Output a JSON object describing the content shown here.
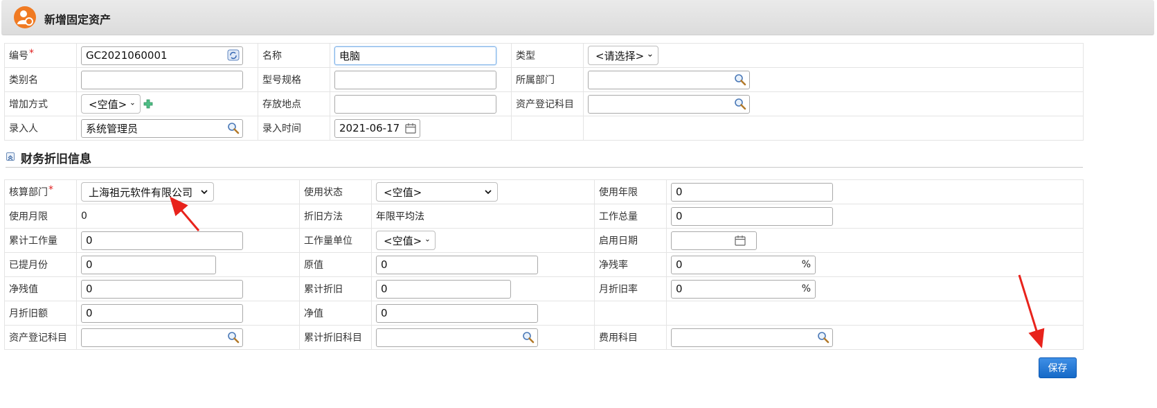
{
  "header": {
    "title": "新增固定资产"
  },
  "basic": {
    "code": {
      "label": "编号",
      "required": "*",
      "value": "GC2021060001"
    },
    "name": {
      "label": "名称",
      "value": "电脑"
    },
    "type": {
      "label": "类型",
      "value": "<请选择>"
    },
    "category_name": {
      "label": "类别名",
      "value": ""
    },
    "model": {
      "label": "型号规格",
      "value": ""
    },
    "department": {
      "label": "所属部门",
      "value": ""
    },
    "add_method": {
      "label": "增加方式",
      "value": "<空值>"
    },
    "location": {
      "label": "存放地点",
      "value": ""
    },
    "asset_account": {
      "label": "资产登记科目",
      "value": ""
    },
    "entered_by": {
      "label": "录入人",
      "value": "系统管理员"
    },
    "entry_time": {
      "label": "录入时间",
      "value": "2021-06-17"
    }
  },
  "finance": {
    "section_title": "财务折旧信息",
    "acct_dept": {
      "label": "核算部门",
      "required": "*",
      "value": "上海祖元软件有限公司"
    },
    "use_status": {
      "label": "使用状态",
      "value": "<空值>"
    },
    "use_years": {
      "label": "使用年限",
      "value": "0"
    },
    "use_months": {
      "label": "使用月限",
      "value": "0"
    },
    "depr_method": {
      "label": "折旧方法",
      "value": "年限平均法"
    },
    "total_work": {
      "label": "工作总量",
      "value": "0"
    },
    "accum_work": {
      "label": "累计工作量",
      "value": "0"
    },
    "work_unit": {
      "label": "工作量单位",
      "value": "<空值>"
    },
    "start_date": {
      "label": "启用日期",
      "value": ""
    },
    "months_accrued": {
      "label": "已提月份",
      "value": "0"
    },
    "original_value": {
      "label": "原值",
      "value": "0"
    },
    "residual_rate": {
      "label": "净残率",
      "value": "0",
      "unit": "%"
    },
    "residual_value": {
      "label": "净残值",
      "value": "0"
    },
    "accum_depr": {
      "label": "累计折旧",
      "value": "0"
    },
    "monthly_rate": {
      "label": "月折旧率",
      "value": "0",
      "unit": "%"
    },
    "monthly_amount": {
      "label": "月折旧额",
      "value": "0"
    },
    "net_value": {
      "label": "净值",
      "value": "0"
    },
    "asset_account": {
      "label": "资产登记科目",
      "value": ""
    },
    "accum_depr_account": {
      "label": "累计折旧科目",
      "value": ""
    },
    "expense_account": {
      "label": "费用科目",
      "value": ""
    }
  },
  "actions": {
    "save_label": "保存"
  },
  "colors": {
    "accent": "#1569c7",
    "required": "#e02020",
    "logo": "#f07a22",
    "arrow": "#e8231c"
  }
}
